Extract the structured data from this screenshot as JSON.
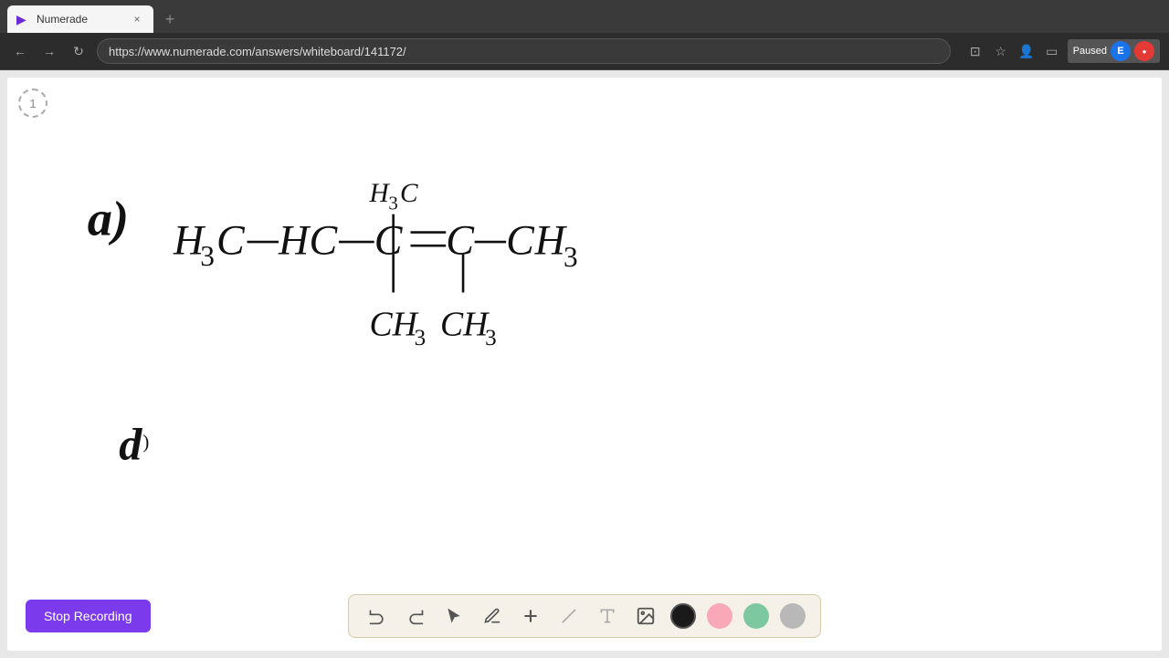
{
  "browser": {
    "tab": {
      "title": "Numerade",
      "favicon": "▶",
      "close": "×",
      "new_tab": "+"
    },
    "url": "https://www.numerade.com/answers/whiteboard/141172/",
    "nav": {
      "back": "←",
      "forward": "→",
      "refresh": "↻"
    },
    "paused_label": "Paused",
    "ext_e": "E",
    "ext_red": "●"
  },
  "whiteboard": {
    "page_number": "1",
    "formula_svg_desc": "Chemical structure drawing"
  },
  "toolbar": {
    "undo_label": "↺",
    "redo_label": "↻",
    "select_label": "↖",
    "pen_label": "✏",
    "plus_label": "+",
    "slash_label": "/",
    "text_label": "A",
    "image_label": "🖼",
    "colors": [
      "black",
      "pink",
      "green",
      "gray"
    ]
  },
  "stop_recording": {
    "label": "Stop Recording"
  }
}
